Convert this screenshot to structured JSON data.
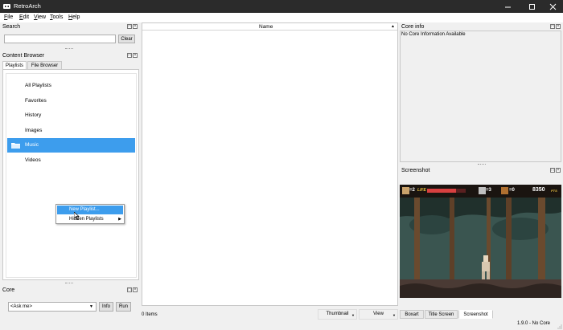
{
  "window": {
    "title": "RetroArch",
    "controls": [
      "minimize",
      "maximize",
      "close"
    ]
  },
  "menu": {
    "items": [
      "File",
      "Edit",
      "View",
      "Tools",
      "Help"
    ],
    "mnemonic_letters": [
      "F",
      "E",
      "V",
      "T",
      "H"
    ],
    "rest": [
      "ile",
      "dit",
      "iew",
      "ools",
      "elp"
    ]
  },
  "search": {
    "title": "Search",
    "value": "",
    "clear_label": "Clear"
  },
  "content_browser": {
    "title": "Content Browser",
    "tabs": [
      "Playlists",
      "File Browser"
    ],
    "active_tab": "Playlists",
    "playlists": [
      {
        "label": "All Playlists",
        "icon": "none"
      },
      {
        "label": "Favorites",
        "icon": "none"
      },
      {
        "label": "History",
        "icon": "none"
      },
      {
        "label": "Images",
        "icon": "none"
      },
      {
        "label": "Music",
        "icon": "folder-icon",
        "selected": true
      },
      {
        "label": "Videos",
        "icon": "none"
      }
    ]
  },
  "context_menu": {
    "items": [
      {
        "label": "New Playlist...",
        "highlighted": true
      },
      {
        "label": "Hidden Playlists",
        "submenu": true
      }
    ]
  },
  "core": {
    "title": "Core",
    "select_value": "<Ask me>",
    "info_label": "Info",
    "run_label": "Run"
  },
  "table": {
    "column_name": "Name",
    "item_count": "0 Items",
    "view_mode": "Thumbnail",
    "view_label": "View"
  },
  "core_info": {
    "title": "Core info",
    "text": "No Core Information Available"
  },
  "screenshot": {
    "title": "Screenshot",
    "tabs": [
      "Boxart",
      "Title Screen",
      "Screenshot"
    ],
    "active_tab": "Screenshot",
    "hud": {
      "lives": "=2",
      "life_label": "LIFE",
      "weapon_count": "=3",
      "item_count": "=0",
      "score": "8350",
      "score_unit": "PTS"
    }
  },
  "status": {
    "version": "1.9.0 - No Core"
  },
  "colors": {
    "titlebar": "#2b2b2b",
    "selection": "#3d9ded",
    "panel_bg": "#f0f0f0"
  }
}
